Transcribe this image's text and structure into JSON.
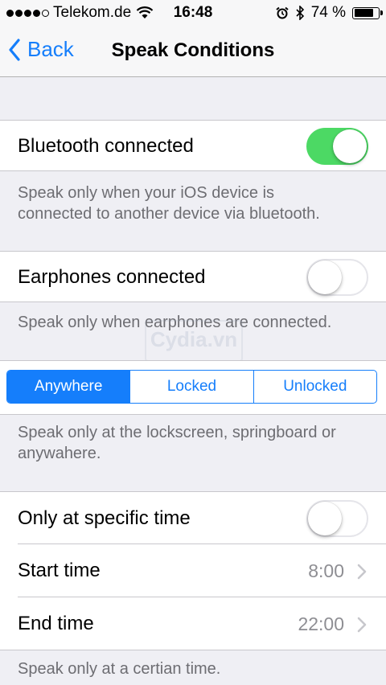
{
  "status_bar": {
    "carrier": "Telekom.de",
    "time": "16:48",
    "battery": "74 %",
    "battery_level": 0.74
  },
  "nav": {
    "back_label": "Back",
    "title": "Speak Conditions"
  },
  "bluetooth": {
    "label": "Bluetooth connected",
    "enabled": true,
    "footer_line1": "Speak only when your iOS device is",
    "footer_line2": "connected to another device via bluetooth."
  },
  "earphones": {
    "label": "Earphones connected",
    "enabled": false,
    "footer": "Speak only when earphones are connected."
  },
  "location": {
    "segments": [
      "Anywhere",
      "Locked",
      "Unlocked"
    ],
    "selected": "Anywhere",
    "footer_line1": "Speak only at the lockscreen, springboard or",
    "footer_line2": "anywahere."
  },
  "schedule": {
    "toggle_label": "Only at specific time",
    "enabled": false,
    "start_label": "Start time",
    "start_value": "8:00",
    "end_label": "End time",
    "end_value": "22:00",
    "footer": "Speak only at a certian time."
  },
  "watermark": "Cydia.vn",
  "colors": {
    "accent": "#157efb",
    "toggle_on": "#4cd964",
    "background": "#efeff4"
  }
}
